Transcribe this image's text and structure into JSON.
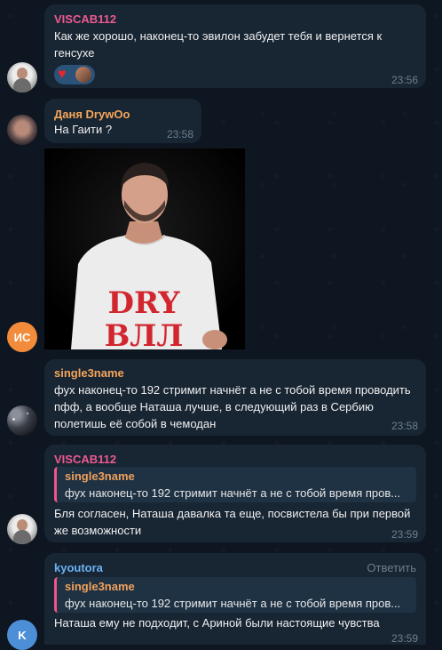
{
  "messages": [
    {
      "sender": "VISCAB112",
      "sender_color": "#ee5a8f",
      "text": "Как же хорошо, наконец-то эвилон забудет тебя и вернется к генсухе",
      "reactions": [
        "heart-icon",
        "user-avatar"
      ],
      "time": "23:56"
    },
    {
      "sender": "Даня DrywOo",
      "sender_color": "#f5a65a",
      "text": "На Гаити ?",
      "time": "23:58"
    },
    {
      "avatar_initials": "ИС",
      "avatar_color": "#f28c3b",
      "photo": {
        "shirt_text_1": "DRY",
        "shirt_text_2": "ВЛЛ"
      }
    },
    {
      "sender": "single3name",
      "sender_color": "#f5a65a",
      "text": "фух наконец-то 192 стримит начнёт а не с тобой время проводить пфф, а вообще Наташа лучше, в следующий раз в Сербию полетишь её собой в чемодан",
      "time": "23:58"
    },
    {
      "sender": "VISCAB112",
      "sender_color": "#ee5a8f",
      "reply": {
        "name": "single3name",
        "text": "фух наконец-то 192 стримит начнёт а не с тобой время пров..."
      },
      "text": "Бля согласен, Наташа давалка та еще, посвистела бы при первой же возможности",
      "time": "23:59"
    },
    {
      "sender": "kyoutora",
      "sender_color": "#6ab3f3",
      "reply_action": "Ответить",
      "reply": {
        "name": "single3name",
        "text": "фух наконец-то 192 стримит начнёт а не с тобой время пров..."
      },
      "text": "Наташа ему не подходит, с Ариной были настоящие чувства",
      "time": "23:59",
      "avatar_initials": "K",
      "avatar_color": "#4d8fd6"
    }
  ]
}
